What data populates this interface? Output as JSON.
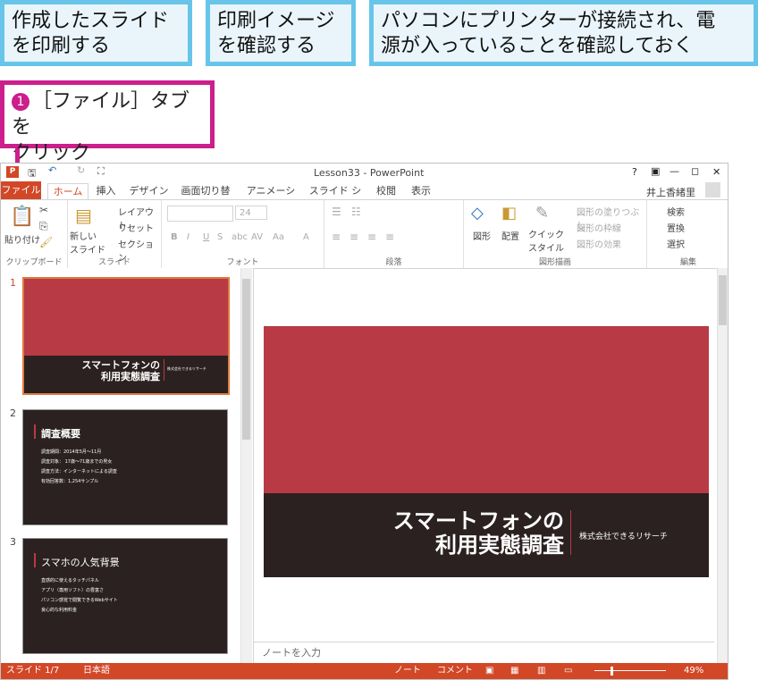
{
  "instructions": {
    "box1": "作成したスライド\nを印刷する",
    "box2": "印刷イメージ\nを確認する",
    "box3": "パソコンにプリンターが接続され、電\n源が入っていることを確認しておく",
    "callout_num": "1",
    "callout_text": "［ファイル］タブを\nクリック"
  },
  "window": {
    "title": "Lesson33 - PowerPoint",
    "controls": [
      "?",
      "▣",
      "—",
      "◻",
      "✕"
    ],
    "user": "井上香緒里"
  },
  "tabs": [
    "ファイル",
    "ホーム",
    "挿入",
    "デザイン",
    "画面切り替え",
    "アニメーション",
    "スライド ショー",
    "校閲",
    "表示"
  ],
  "ribbon": {
    "clipboard": {
      "paste": "貼り付け",
      "label": "クリップボード"
    },
    "slides": {
      "new_slide": "新しい\nスライド",
      "layout": "レイアウト",
      "reset": "リセット",
      "section": "セクション",
      "label": "スライド"
    },
    "font": {
      "size": "24",
      "label": "フォント",
      "buttons": [
        "B",
        "I",
        "U",
        "S",
        "abc",
        "AV",
        "Aa",
        "A"
      ]
    },
    "paragraph": {
      "label": "段落"
    },
    "drawing": {
      "shape": "図形",
      "arrange": "配置",
      "quick_style": "クイック\nスタイル",
      "fill": "図形の塗りつぶし",
      "outline": "図形の枠線",
      "effect": "図形の効果",
      "label": "図形描画"
    },
    "editing": {
      "find": "検索",
      "replace": "置換",
      "select": "選択",
      "label": "編集"
    }
  },
  "slides": [
    {
      "num": "1",
      "title": "スマートフォンの\n利用実態調査",
      "subtitle": "株式会社できるリサーチ"
    },
    {
      "num": "2",
      "title": "調査概要",
      "items": [
        "調査期間：2014年5月～11月",
        "調査対象： 17歳～71歳までの男女",
        "調査方法：インターネットによる調査",
        "有効回答数：1,254サンプル"
      ]
    },
    {
      "num": "3",
      "title": "スマホの人気背景",
      "items": [
        "直感的に使えるタッチパネル",
        "アプリ（専用ソフト）の豊富さ",
        "パソコン感覚で閲覧できるWebサイト",
        "良心的な利用料金"
      ]
    }
  ],
  "main_slide": {
    "title": "スマートフォンの\n利用実態調査",
    "subtitle": "株式会社できるリサーチ"
  },
  "notes_placeholder": "ノートを入力",
  "status": {
    "slide": "スライド 1/7",
    "language": "日本語",
    "notes": "ノート",
    "comments": "コメント",
    "zoom": "49%"
  },
  "colors": {
    "accent": "#d24726",
    "slide_red": "#b83a44",
    "slide_dark": "#2b2120",
    "callout": "#cc1e8c",
    "box_border": "#68c5e9"
  }
}
